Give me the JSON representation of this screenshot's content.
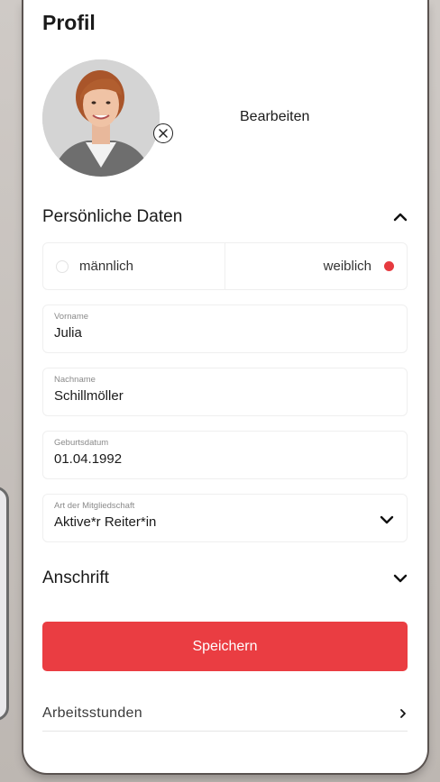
{
  "profile": {
    "title": "Profil",
    "edit_label": "Bearbeiten"
  },
  "personal": {
    "section_title": "Persönliche Daten",
    "gender": {
      "male_label": "männlich",
      "female_label": "weiblich",
      "selected": "weiblich"
    },
    "fields": {
      "first_name": {
        "label": "Vorname",
        "value": "Julia"
      },
      "last_name": {
        "label": "Nachname",
        "value": "Schillmöller"
      },
      "birthdate": {
        "label": "Geburtsdatum",
        "value": "01.04.1992"
      },
      "membership": {
        "label": "Art der Mitgliedschaft",
        "value": "Aktive*r Reiter*in"
      }
    }
  },
  "address": {
    "section_title": "Anschrift"
  },
  "actions": {
    "save_label": "Speichern",
    "work_hours_label": "Arbeitsstunden"
  },
  "colors": {
    "accent": "#ea3d42",
    "radio_selected": "#e63a3f"
  },
  "icons": {
    "avatar_remove": "close-circle-icon",
    "personal_toggle": "chevron-up-icon",
    "membership_select": "chevron-down-icon",
    "address_toggle": "chevron-down-icon",
    "work_hours_nav": "chevron-right-icon"
  }
}
